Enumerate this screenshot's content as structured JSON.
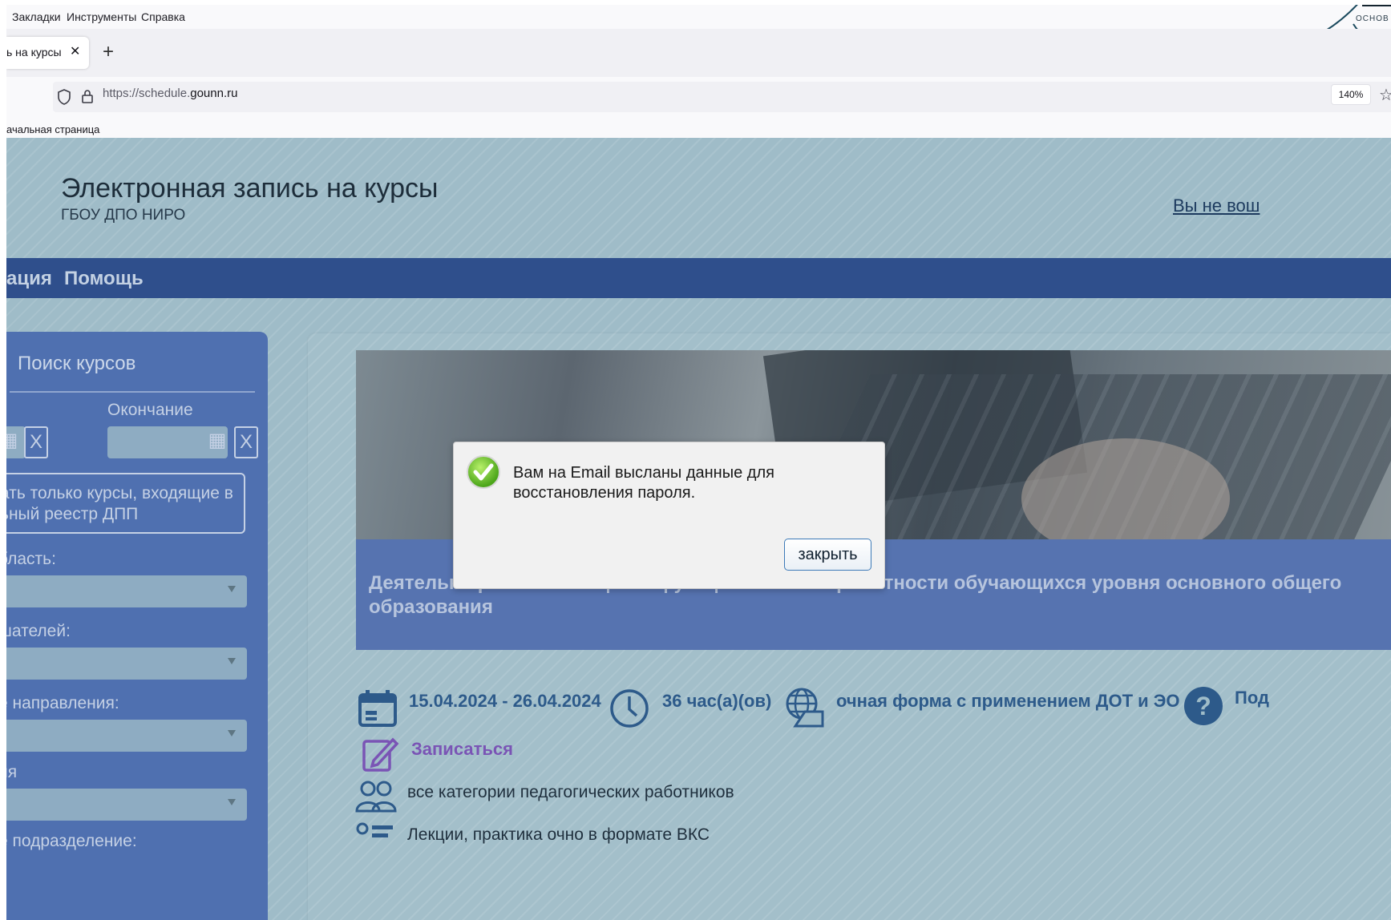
{
  "browser": {
    "menu": [
      "Закладки",
      "Инструменты",
      "Справка"
    ],
    "tab_label": "ь на курсы",
    "tab_close": "✕",
    "new_tab": "+",
    "url_prefix": "https://schedule.",
    "url_domain": "gounn.ru",
    "zoom": "140%",
    "bookmark": "ачальная страница",
    "logo_text": "ОСНОВ"
  },
  "site": {
    "title": "Электронная запись на курсы",
    "subtitle": "ГБОУ ДПО НИРО",
    "login_link": "Вы не вош",
    "nav": [
      "ация",
      "Помощь"
    ]
  },
  "sidebar": {
    "title": "Поиск курсов",
    "end_label": "Окончание",
    "clear": "X",
    "checkbox_lines": [
      "ать только курсы, входящие в",
      "ьный реестр ДПП"
    ],
    "fields": [
      "бласть:",
      "шателей:",
      "е направления:",
      "ия",
      "е подразделение:"
    ]
  },
  "course": {
    "title": "Деятельн                                                          ированию и оценке функциональной грамотности обучающихся уровня основного общего образования",
    "dates": "15.04.2024 - 26.04.2024",
    "hours": "36 час(а)(ов)",
    "form": "очная форма с применением ДОТ и ЭО",
    "more": "Под",
    "enroll": "Записаться",
    "audience": "все категории педагогических работников",
    "format": "Лекции, практика очно в формате ВКС"
  },
  "modal": {
    "message": "Вам на Email высланы данные для восстановления пароля.",
    "close_label": "закрыть"
  },
  "colors": {
    "nav_bg": "#2f4f8c",
    "sidebar_bg": "#4f70b0",
    "accent_text": "#2d5a8a",
    "enroll": "#7a54b5"
  }
}
